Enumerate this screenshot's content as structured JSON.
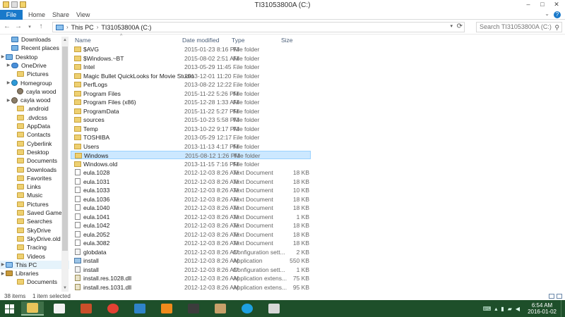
{
  "window": {
    "title": "TI31053800A (C:)",
    "controls": [
      "–",
      "□",
      "✕"
    ]
  },
  "ribbon": {
    "tabs": [
      "File",
      "Home",
      "Share",
      "View"
    ],
    "help": "?",
    "expand": "⌄"
  },
  "address": {
    "path": [
      "This PC",
      "TI31053800A (C:)"
    ],
    "search_placeholder": "Search TI31053800A (C:)"
  },
  "nav": {
    "items": [
      {
        "label": "Downloads",
        "icon": "downloads-icon",
        "indent": 1
      },
      {
        "label": "Recent places",
        "icon": "recent-places-icon",
        "indent": 1
      },
      {
        "label": "Desktop",
        "icon": "desktop-icon",
        "indent": 0
      },
      {
        "label": "OneDrive",
        "icon": "onedrive-icon",
        "indent": 1
      },
      {
        "label": "Pictures",
        "icon": "folder-icon",
        "indent": 2
      },
      {
        "label": "Homegroup",
        "icon": "homegroup-icon",
        "indent": 1
      },
      {
        "label": "cayla wood",
        "icon": "user-icon",
        "indent": 2
      },
      {
        "label": "cayla wood",
        "icon": "user-icon",
        "indent": 1
      },
      {
        "label": ".android",
        "icon": "folder-icon",
        "indent": 2
      },
      {
        "label": ".dvdcss",
        "icon": "folder-icon",
        "indent": 2
      },
      {
        "label": "AppData",
        "icon": "folder-icon",
        "indent": 2
      },
      {
        "label": "Contacts",
        "icon": "folder-icon",
        "indent": 2
      },
      {
        "label": "Cyberlink",
        "icon": "folder-icon",
        "indent": 2
      },
      {
        "label": "Desktop",
        "icon": "folder-icon",
        "indent": 2
      },
      {
        "label": "Documents",
        "icon": "folder-icon",
        "indent": 2
      },
      {
        "label": "Downloads",
        "icon": "folder-icon",
        "indent": 2
      },
      {
        "label": "Favorites",
        "icon": "folder-icon",
        "indent": 2
      },
      {
        "label": "Links",
        "icon": "folder-icon",
        "indent": 2
      },
      {
        "label": "Music",
        "icon": "folder-icon",
        "indent": 2
      },
      {
        "label": "Pictures",
        "icon": "folder-icon",
        "indent": 2
      },
      {
        "label": "Saved Games",
        "icon": "folder-icon",
        "indent": 2
      },
      {
        "label": "Searches",
        "icon": "folder-icon",
        "indent": 2
      },
      {
        "label": "SkyDrive",
        "icon": "folder-icon",
        "indent": 2
      },
      {
        "label": "SkyDrive.old",
        "icon": "folder-icon",
        "indent": 2
      },
      {
        "label": "Tracing",
        "icon": "folder-icon",
        "indent": 2
      },
      {
        "label": "Videos",
        "icon": "folder-icon",
        "indent": 2
      },
      {
        "label": "This PC",
        "icon": "this-pc-icon",
        "indent": 0,
        "selected": true
      },
      {
        "label": "Libraries",
        "icon": "libraries-icon",
        "indent": 0
      },
      {
        "label": "Documents",
        "icon": "folder-icon",
        "indent": 2
      }
    ]
  },
  "columns": {
    "name": "Name",
    "date": "Date modified",
    "type": "Type",
    "size": "Size"
  },
  "files": [
    {
      "name": "$AVG",
      "date": "2015-01-23 8:16 PM",
      "type": "File folder",
      "size": "",
      "kind": "folder"
    },
    {
      "name": "$Windows.~BT",
      "date": "2015-08-02 2:51 AM",
      "type": "File folder",
      "size": "",
      "kind": "folder"
    },
    {
      "name": "Intel",
      "date": "2013-05-29 11:45 ...",
      "type": "File folder",
      "size": "",
      "kind": "folder"
    },
    {
      "name": "Magic Bullet QuickLooks for Movie Studio",
      "date": "2013-12-01 11:20 ...",
      "type": "File folder",
      "size": "",
      "kind": "folder"
    },
    {
      "name": "PerfLogs",
      "date": "2013-08-22 12:22 ...",
      "type": "File folder",
      "size": "",
      "kind": "folder"
    },
    {
      "name": "Program Files",
      "date": "2015-11-22 5:26 PM",
      "type": "File folder",
      "size": "",
      "kind": "folder"
    },
    {
      "name": "Program Files (x86)",
      "date": "2015-12-28 1:33 AM",
      "type": "File folder",
      "size": "",
      "kind": "folder"
    },
    {
      "name": "ProgramData",
      "date": "2015-11-22 5:27 PM",
      "type": "File folder",
      "size": "",
      "kind": "folder"
    },
    {
      "name": "sources",
      "date": "2015-10-23 5:58 PM",
      "type": "File folder",
      "size": "",
      "kind": "folder"
    },
    {
      "name": "Temp",
      "date": "2013-10-22 9:17 PM",
      "type": "File folder",
      "size": "",
      "kind": "folder"
    },
    {
      "name": "TOSHIBA",
      "date": "2013-05-29 12:17 ...",
      "type": "File folder",
      "size": "",
      "kind": "folder"
    },
    {
      "name": "Users",
      "date": "2013-11-13 4:17 PM",
      "type": "File folder",
      "size": "",
      "kind": "folder"
    },
    {
      "name": "Windows",
      "date": "2015-08-12 1:26 PM",
      "type": "File folder",
      "size": "",
      "kind": "folder",
      "selected": true
    },
    {
      "name": "Windows.old",
      "date": "2013-11-15 7:16 PM",
      "type": "File folder",
      "size": "",
      "kind": "folder"
    },
    {
      "name": "eula.1028",
      "date": "2012-12-03 8:26 AM",
      "type": "Text Document",
      "size": "18 KB",
      "kind": "doc"
    },
    {
      "name": "eula.1031",
      "date": "2012-12-03 8:26 AM",
      "type": "Text Document",
      "size": "18 KB",
      "kind": "doc"
    },
    {
      "name": "eula.1033",
      "date": "2012-12-03 8:26 AM",
      "type": "Text Document",
      "size": "10 KB",
      "kind": "doc"
    },
    {
      "name": "eula.1036",
      "date": "2012-12-03 8:26 AM",
      "type": "Text Document",
      "size": "18 KB",
      "kind": "doc"
    },
    {
      "name": "eula.1040",
      "date": "2012-12-03 8:26 AM",
      "type": "Text Document",
      "size": "18 KB",
      "kind": "doc"
    },
    {
      "name": "eula.1041",
      "date": "2012-12-03 8:26 AM",
      "type": "Text Document",
      "size": "1 KB",
      "kind": "doc"
    },
    {
      "name": "eula.1042",
      "date": "2012-12-03 8:26 AM",
      "type": "Text Document",
      "size": "18 KB",
      "kind": "doc"
    },
    {
      "name": "eula.2052",
      "date": "2012-12-03 8:26 AM",
      "type": "Text Document",
      "size": "18 KB",
      "kind": "doc"
    },
    {
      "name": "eula.3082",
      "date": "2012-12-03 8:26 AM",
      "type": "Text Document",
      "size": "18 KB",
      "kind": "doc"
    },
    {
      "name": "globdata",
      "date": "2012-12-03 8:26 AM",
      "type": "Configuration sett...",
      "size": "2 KB",
      "kind": "cfg"
    },
    {
      "name": "install",
      "date": "2012-12-03 8:26 AM",
      "type": "Application",
      "size": "550 KB",
      "kind": "app"
    },
    {
      "name": "install",
      "date": "2012-12-03 8:26 AM",
      "type": "Configuration sett...",
      "size": "1 KB",
      "kind": "cfg"
    },
    {
      "name": "install.res.1028.dll",
      "date": "2012-12-03 8:26 AM",
      "type": "Application extens...",
      "size": "75 KB",
      "kind": "dll"
    },
    {
      "name": "install.res.1031.dll",
      "date": "2012-12-03 8:26 AM",
      "type": "Application extens...",
      "size": "95 KB",
      "kind": "dll"
    }
  ],
  "status": {
    "count": "38 items",
    "selected": "1 item selected"
  },
  "taskbar": {
    "apps": [
      {
        "icon": "file-explorer-icon",
        "color": "#e8c45a",
        "active": true
      },
      {
        "icon": "wordperfect-icon",
        "color": "#f2f2f2",
        "active": false
      },
      {
        "icon": "tiles-app-icon",
        "color": "#c94f2a",
        "active": false
      },
      {
        "icon": "chrome-icon",
        "color": "#e34133",
        "active": false
      },
      {
        "icon": "store-icon",
        "color": "#2f83c9",
        "active": false
      },
      {
        "icon": "media-player-icon",
        "color": "#f08a1c",
        "active": false
      },
      {
        "icon": "tv-app-icon",
        "color": "#3c3c3c",
        "active": false
      },
      {
        "icon": "stamp-app-icon",
        "color": "#c8a06a",
        "active": false
      },
      {
        "icon": "skype-icon",
        "color": "#1ea0e1",
        "active": false
      },
      {
        "icon": "paint-icon",
        "color": "#d7d7d7",
        "active": false
      }
    ],
    "tray": {
      "time": "6:54 AM",
      "date": "2016-01-02"
    }
  }
}
